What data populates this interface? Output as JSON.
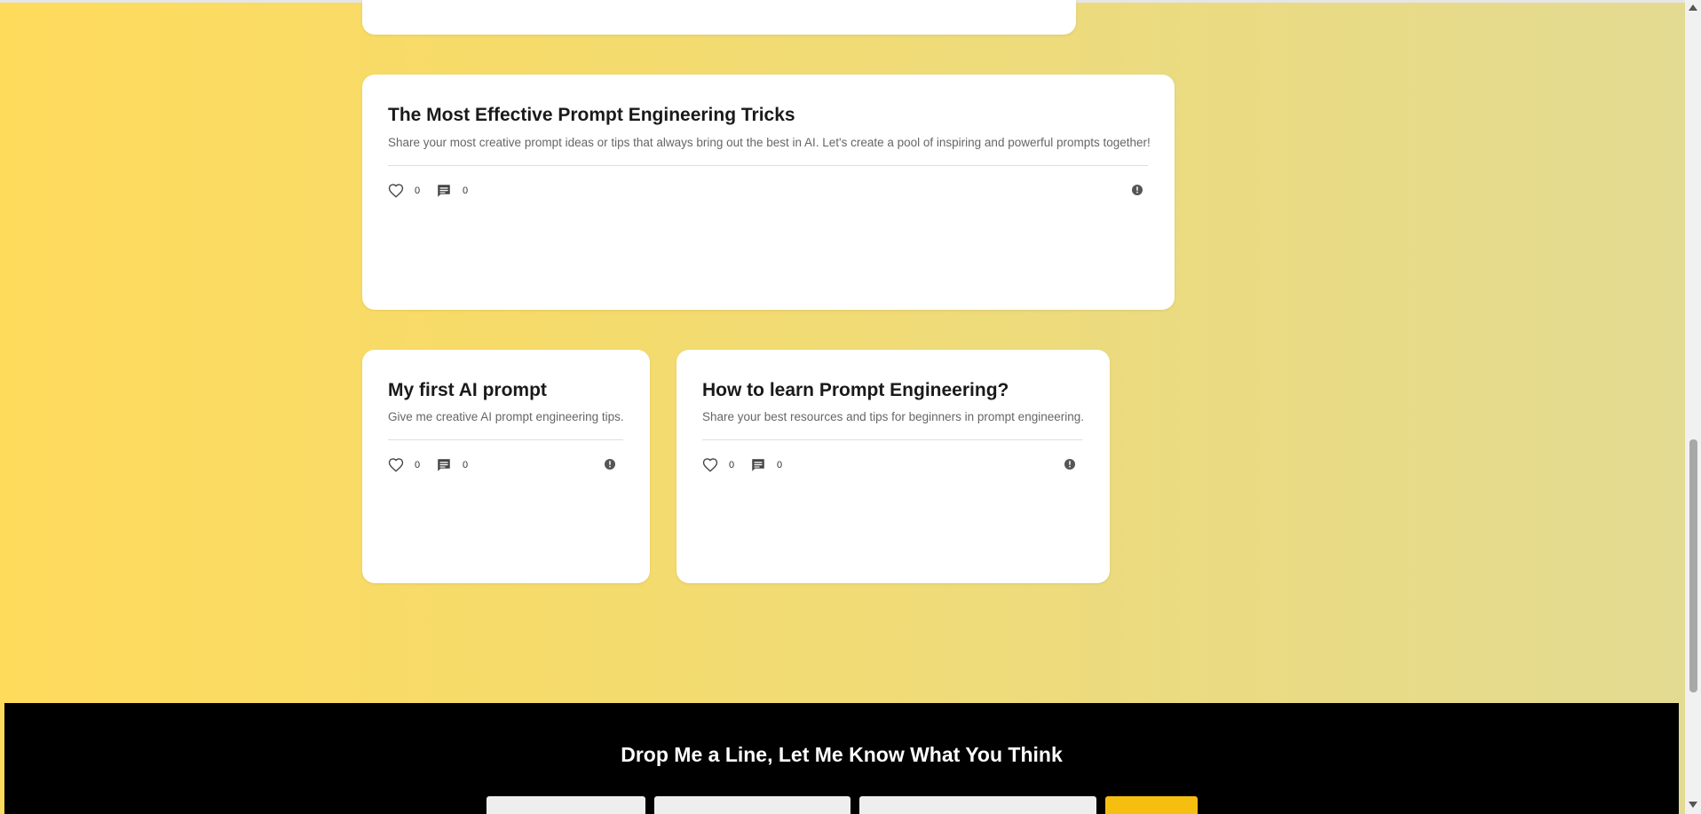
{
  "colors": {
    "background_gradient": [
      "#ffdb5c",
      "#e3db92"
    ],
    "card": "#ffffff",
    "footer": "#000000",
    "accent": "#f6be0e"
  },
  "posts": [
    {
      "title": "The Most Effective Prompt Engineering Tricks",
      "description": "Share your most creative prompt ideas or tips that always bring out the best in AI. Let's create a pool of inspiring and powerful prompts together!",
      "likes": "0",
      "comments": "0",
      "icons": {
        "like": "heart-outline-icon",
        "comment": "comment-icon",
        "report": "alert-circle-icon"
      }
    },
    {
      "title": "My first AI prompt",
      "description": "Give me creative AI prompt engineering tips.",
      "likes": "0",
      "comments": "0",
      "icons": {
        "like": "heart-outline-icon",
        "comment": "comment-icon",
        "report": "alert-circle-icon"
      }
    },
    {
      "title": "How to learn Prompt Engineering?",
      "description": "Share your best resources and tips for beginners in prompt engineering.",
      "likes": "0",
      "comments": "0",
      "icons": {
        "like": "heart-outline-icon",
        "comment": "comment-icon",
        "report": "alert-circle-icon"
      }
    }
  ],
  "footer": {
    "title": "Drop Me a Line, Let Me Know What You Think"
  }
}
